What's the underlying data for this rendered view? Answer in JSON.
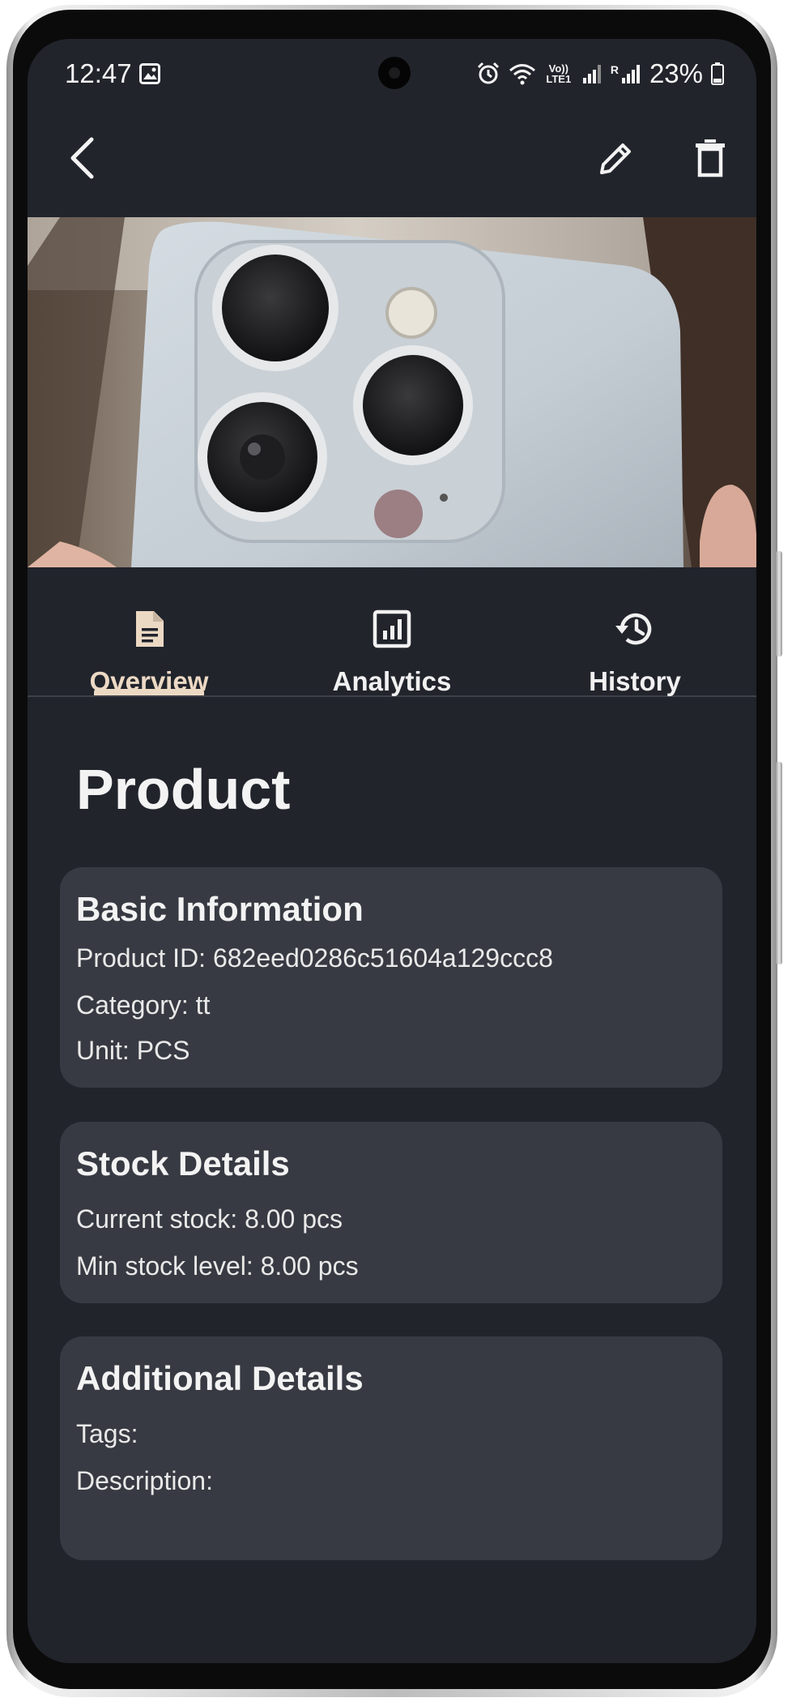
{
  "status_bar": {
    "time": "12:47",
    "battery_percent": "23%",
    "icons": [
      "gallery-icon",
      "alarm-icon",
      "wifi-icon",
      "volte-icon",
      "signal-icon",
      "roaming-signal-icon",
      "battery-icon"
    ],
    "volte_label": "Vo)) LTE1",
    "roaming_label": "R"
  },
  "app_bar": {
    "back_icon": "back-arrow-icon",
    "edit_icon": "pencil-icon",
    "delete_icon": "trash-icon"
  },
  "product_image": {
    "subject": "phone-rear-camera-photo"
  },
  "tabs": [
    {
      "label": "Overview",
      "icon": "document-icon",
      "active": true
    },
    {
      "label": "Analytics",
      "icon": "bar-chart-icon",
      "active": false
    },
    {
      "label": "History",
      "icon": "history-icon",
      "active": false
    }
  ],
  "page": {
    "title": "Product"
  },
  "cards": {
    "basic": {
      "title": "Basic Information",
      "product_id": "Product ID: 682eed0286c51604a129ccc8",
      "category": "Category: tt",
      "unit": "Unit: PCS"
    },
    "stock": {
      "title": "Stock Details",
      "current_stock": "Current stock: 8.00 pcs",
      "min_stock": "Min stock level: 8.00 pcs"
    },
    "additional": {
      "title": "Additional Details",
      "tags": "Tags:",
      "description": "Description:"
    }
  },
  "colors": {
    "background": "#21242b",
    "card": "#373a42",
    "accent": "#ecd9c4",
    "text": "#f1f1f1"
  }
}
